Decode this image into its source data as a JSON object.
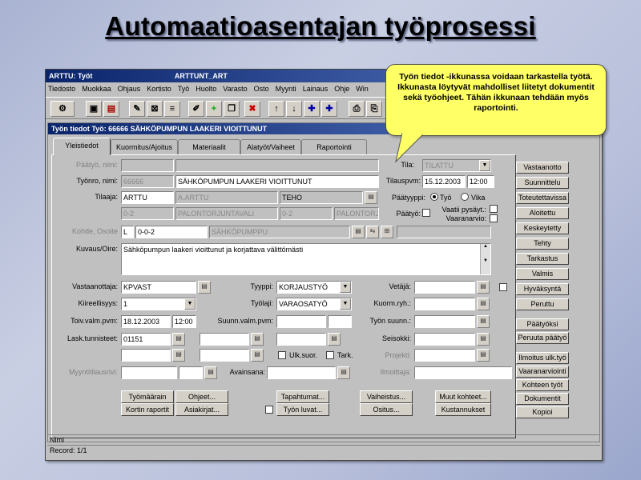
{
  "slide": {
    "title": "Automaatioasentajan työprosessi"
  },
  "callout": {
    "text": "Työn tiedot -ikkunassa voidaan tarkastella työtä. Ikkunasta löytyvät mahdolliset liitetyt dokumentit sekä työohjeet. Tähän ikkunaan tehdään myös raportointi."
  },
  "window": {
    "title": "ARTTU: Työt",
    "subtitle": "ARTTUNT_ART"
  },
  "menu": [
    "Tiedosto",
    "Muokkaa",
    "Ohjaus",
    "Kortisto",
    "Työ",
    "Huolto",
    "Varasto",
    "Osto",
    "Myynti",
    "Lainaus",
    "Ohje",
    "Win"
  ],
  "toolbar": {
    "icons": [
      "users-icon",
      "save-icon",
      "exit-icon",
      "edit-icon",
      "edit-2-icon",
      "pencil-icon",
      "add-icon",
      "copy-icon",
      "delete-icon",
      "arrow-up-icon",
      "arrow-down-icon",
      "plus-icon",
      "plus-2-icon",
      "print-icon",
      "print-2-icon"
    ]
  },
  "inner": {
    "title": "Työn tiedot  Työ: 66666 SÄHKÖPUMPUN LAAKERI VIOITTUNUT"
  },
  "tabs": [
    "Yleistiedot",
    "Kuormitus/Ajoitus",
    "Materiaalit",
    "Alatyöt/Vaiheet",
    "Raportointi"
  ],
  "form": {
    "paatyo_label": "Päätyö, nimi:",
    "tyonro_label": "Työnro, nimi:",
    "tyonro": "66666",
    "tyonimi": "SÄHKÖPUMPUN LAAKERI VIOITTUNUT",
    "tila_label": "Tila:",
    "tila": "TILATTU",
    "tilauspvm_label": "Tilauspvm:",
    "tilauspvm": "15.12.2003",
    "tilausklo": "12:00",
    "tilaaja_label": "Tilaaja:",
    "tilaaja": "ARTTU",
    "tilaaja_nimi": "A.ARTTU",
    "tilaaja_osasto": "TEHO",
    "row2a": "0-2",
    "row2b": "PALONTORJUNTAVALI",
    "row2c": "0-2",
    "row2d": "PALONTORJUNT",
    "paatyyppi_label": "Päätyyppi:",
    "paatyyppi_tyo": "Työ",
    "paatyyppi_vika": "Vika",
    "paatyo_cb_label": "Päätyö:",
    "vaatii_label": "Vaatii pysäyt.:",
    "vaaranarvio_label": "Vaaranarvio:",
    "kohde_label": "Kohde, Osoite",
    "kohde_a": "L",
    "kohde_b": "0-0-2",
    "kohde_c": "SÄHKÖPUMPPU",
    "kuvaus_label": "Kuvaus/Oire:",
    "kuvaus": "Sähköpumpun laakeri vioittunut ja korjattava välittömästi",
    "vastaanottaja_label": "Vastaanottaja:",
    "vastaanottaja": "KPVAST",
    "tyyppi_label": "Tyyppi:",
    "tyyppi": "KORJAUSTYÖ",
    "vetaja_label": "Vetäjä:",
    "kiireellisyys_label": "Kiireellisyys:",
    "kiireellisyys": "1",
    "tyolaji_label": "Työlaji:",
    "tyolaji": "VARAOSATYÖ",
    "kuormryh_label": "Kuorm.ryh.:",
    "toivvalm_label": "Toiv.valm.pvm:",
    "toivvalm": "18.12.2003",
    "toivvalmklo": "12:00",
    "suunnvalm_label": "Suunn.valm.pvm:",
    "tyonsuunn_label": "Työn suunn.:",
    "lasktunnisteet_label": "Lask.tunnisteet:",
    "lasktunnisteet": "01151",
    "seisokki_label": "Seisokki:",
    "projekti_label": "Projekti:",
    "ulksuor_label": "Ulk.suor.",
    "tark_label": "Tark.",
    "myyntitilausrivi_label": "Myyntitilausrivi:",
    "avainsana_label": "Avainsana:",
    "ilmoittaja_label": "Ilmoittaja:"
  },
  "bottom_buttons": [
    [
      "Työmäärain",
      "Ohjeet...",
      "Tapahtumat...",
      "Vaiheistus...",
      "Muut kohteet..."
    ],
    [
      "Kortin raportit",
      "Asiakirjat...",
      "Työn luvat...",
      "Ositus...",
      "Kustannukset"
    ]
  ],
  "right_buttons": [
    "Vastaanotto",
    "Suunnittelu",
    "Toteutettavissa",
    "Aloitettu",
    "Keskeytetty",
    "Tehty",
    "Tarkastus",
    "Valmis",
    "Hyväksyntä",
    "Peruttu",
    "Päätyöksi",
    "Peruuta päätyö",
    "Ilmoitus ulk.työ",
    "Vaaranarviointi",
    "Kohteen työt",
    "Dokumentit",
    "Kopioi"
  ],
  "status": {
    "field": "Nimi",
    "record": "Record: 1/1"
  }
}
